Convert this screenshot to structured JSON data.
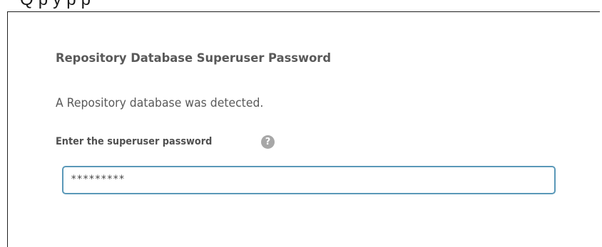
{
  "top_strip": {
    "partial_text": "Q    p     y              p     p"
  },
  "panel": {
    "title": "Repository Database Superuser Password",
    "detected_message": "A Repository database was detected.",
    "password_label": "Enter the superuser password",
    "help_icon": "question-mark-circle-icon",
    "help_glyph": "?",
    "password_value": "*********"
  },
  "colors": {
    "title_text": "#595959",
    "body_text": "#595959",
    "help_icon_bg": "#a7a7a7",
    "input_focus_border": "#5a98b8"
  }
}
